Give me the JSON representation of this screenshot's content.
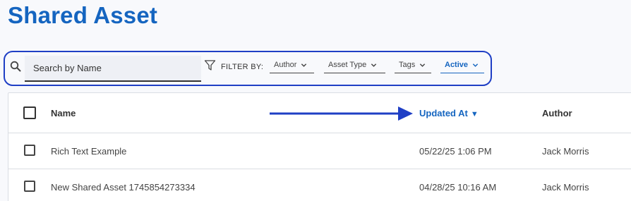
{
  "page": {
    "title": "Shared Asset"
  },
  "search": {
    "placeholder": "Search by Name",
    "value": ""
  },
  "filters": {
    "label": "FILTER BY:",
    "author": "Author",
    "asset_type": "Asset Type",
    "tags": "Tags",
    "status": "Active"
  },
  "table": {
    "columns": {
      "name": "Name",
      "updated_at": "Updated At",
      "author": "Author"
    },
    "sort_indicator": "▼",
    "rows": [
      {
        "name": "Rich Text Example",
        "updated_at": "05/22/25 1:06 PM",
        "author": "Jack Morris"
      },
      {
        "name": "New Shared Asset 1745854273334",
        "updated_at": "04/28/25 10:16 AM",
        "author": "Jack Morris"
      }
    ]
  },
  "colors": {
    "accent": "#1565c0",
    "annotation_blue": "#1f3fc5"
  },
  "icons": {
    "search": "search-icon",
    "filter": "filter-icon",
    "dropdown": "chevron-down-icon",
    "annotation": "arrow-right-annotation"
  }
}
